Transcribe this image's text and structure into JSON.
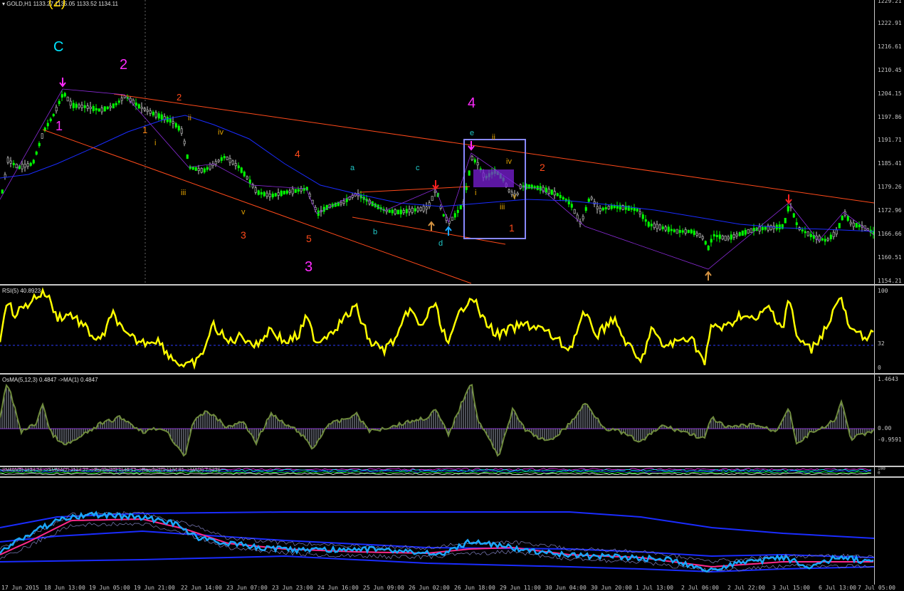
{
  "main": {
    "header": "GOLD,H1  1133.27 1135.05 1133.52 1134.11",
    "top_marker": "(2)",
    "price_ticks": [
      "1229.21",
      "1222.91",
      "1216.61",
      "1210.45",
      "1204.15",
      "1197.86",
      "1191.71",
      "1185.41",
      "1179.26",
      "1172.96",
      "1166.66",
      "1160.51",
      "1154.21"
    ],
    "wave_labels": [
      {
        "t": "C",
        "c": "#00e5ff",
        "s": 20
      },
      {
        "t": "2",
        "c": "#ff2bff",
        "s": 20
      },
      {
        "t": "1",
        "c": "#ff2bff",
        "s": 18
      },
      {
        "t": "2",
        "c": "#ff4a1a",
        "s": 13
      },
      {
        "t": "1",
        "c": "#ff8a1a",
        "s": 13
      },
      {
        "t": "i",
        "c": "#e0a000",
        "s": 11
      },
      {
        "t": "ii",
        "c": "#e0a000",
        "s": 11
      },
      {
        "t": "iii",
        "c": "#e0a000",
        "s": 11
      },
      {
        "t": "iv",
        "c": "#e0a000",
        "s": 11
      },
      {
        "t": "v",
        "c": "#e0a000",
        "s": 11
      },
      {
        "t": "3",
        "c": "#ff4a1a",
        "s": 14
      },
      {
        "t": "4",
        "c": "#ff4a1a",
        "s": 14
      },
      {
        "t": "5",
        "c": "#ff4a1a",
        "s": 14
      },
      {
        "t": "3",
        "c": "#ff2bff",
        "s": 20
      },
      {
        "t": "a",
        "c": "#20c8c8",
        "s": 11
      },
      {
        "t": "b",
        "c": "#20c8c8",
        "s": 11
      },
      {
        "t": "c",
        "c": "#20c8c8",
        "s": 11
      },
      {
        "t": "d",
        "c": "#20c8c8",
        "s": 11
      },
      {
        "t": "e",
        "c": "#20c8c8",
        "s": 11
      },
      {
        "t": "4",
        "c": "#ff2bff",
        "s": 20
      },
      {
        "t": "ii",
        "c": "#e0a000",
        "s": 11
      },
      {
        "t": "iv",
        "c": "#e0a000",
        "s": 11
      },
      {
        "t": "i",
        "c": "#e0a000",
        "s": 11
      },
      {
        "t": "iii",
        "c": "#e0a000",
        "s": 11
      },
      {
        "t": "v",
        "c": "#e0a000",
        "s": 11
      },
      {
        "t": "1",
        "c": "#ff4a1a",
        "s": 14
      },
      {
        "t": "2",
        "c": "#ff4a1a",
        "s": 14
      }
    ]
  },
  "rsi": {
    "header": "RSI(5) 40.8923",
    "ticks": [
      "100",
      "32",
      "0"
    ]
  },
  "osma": {
    "header": "OsMA(5,12,3) 0.4847  ->MA(1) 0.4847",
    "ticks": [
      "1.4643",
      "0.00",
      "-0.9591"
    ]
  },
  "band": {
    "header": "SMMA(5) 1134.76  ->SMMA(2) 1134.27  ->Bands(20) 1149.12  ->Bands(20) 1134.91  ->MA(4) 7.5236",
    "ticks": [
      "100",
      "0"
    ]
  },
  "time_axis": [
    "17 Jun 2015",
    "18 Jun 13:00",
    "19 Jun 05:00",
    "19 Jun 21:00",
    "22 Jun 14:00",
    "23 Jun 07:00",
    "23 Jun 23:00",
    "24 Jun 16:00",
    "25 Jun 09:00",
    "26 Jun 02:00",
    "26 Jun 18:00",
    "29 Jun 11:00",
    "30 Jun 04:00",
    "30 Jun 20:00",
    "1 Jul 13:00",
    "2 Jul 06:00",
    "2 Jul 22:00",
    "3 Jul 15:00",
    "6 Jul 13:00",
    "7 Jul 05:00"
  ],
  "colors": {
    "bull": "#00ff00",
    "bear": "#c8c8c8",
    "rsi": "#ffff00",
    "osma": "#6e8a3c",
    "blue": "#1a2cff",
    "orange": "#ff4a1a",
    "box": "#8888ff",
    "cyan": "#1aa7ff",
    "pink": "#ff2a8a"
  }
}
